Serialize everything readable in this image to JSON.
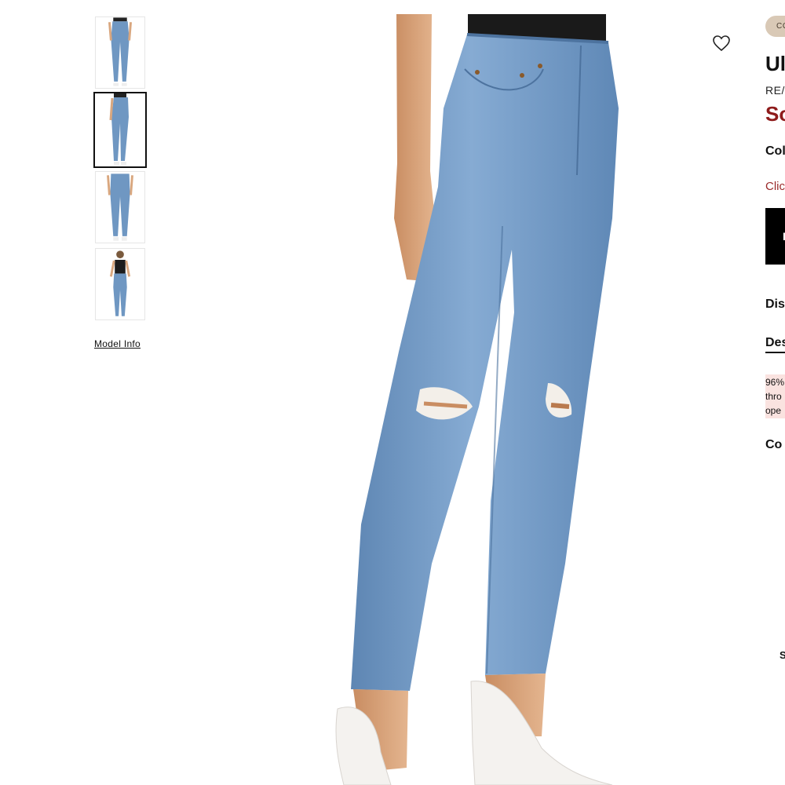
{
  "gallery": {
    "model_info_label": "Model Info",
    "active_index": 1
  },
  "product": {
    "badge": "CO",
    "title": "Ul",
    "brand": "RE/",
    "price": "So",
    "color_label": "Col",
    "size_link": "Clic",
    "add_button": "I",
    "discount_label": "Dis",
    "description_tab": "Des",
    "description_lines": [
      "96%",
      "thro",
      "ope"
    ],
    "composition_label": "Co",
    "trailing_letter": "S"
  },
  "colors": {
    "denim": "#6f97c2",
    "price_red": "#8e1b1b",
    "badge_bg": "#d9c9b6",
    "desc_bg": "#fae3e0"
  }
}
